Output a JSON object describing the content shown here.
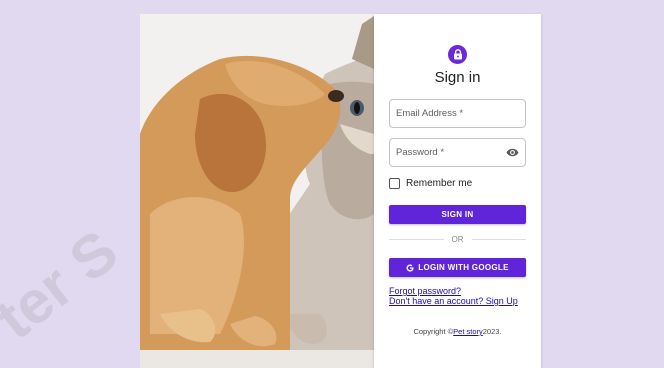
{
  "signin": {
    "title": "Sign in",
    "email_label": "Email Address *",
    "password_label": "Password *",
    "remember_label": "Remember me",
    "signin_button": "SIGN IN",
    "divider_text": "OR",
    "google_button": "LOGIN WITH GOOGLE",
    "forgot_link": "Forgot password?",
    "signup_link": "Don't have an account? Sign Up"
  },
  "footer": {
    "prefix": "Copyright ©",
    "brand_link": "Pet story",
    "suffix": "2023."
  },
  "icons": {
    "lock": "lock-icon",
    "eye": "eye-icon",
    "google": "google-icon"
  },
  "colors": {
    "page_background": "#e1d9ef",
    "accent": "#6025d9",
    "link": "#1a0dab"
  }
}
